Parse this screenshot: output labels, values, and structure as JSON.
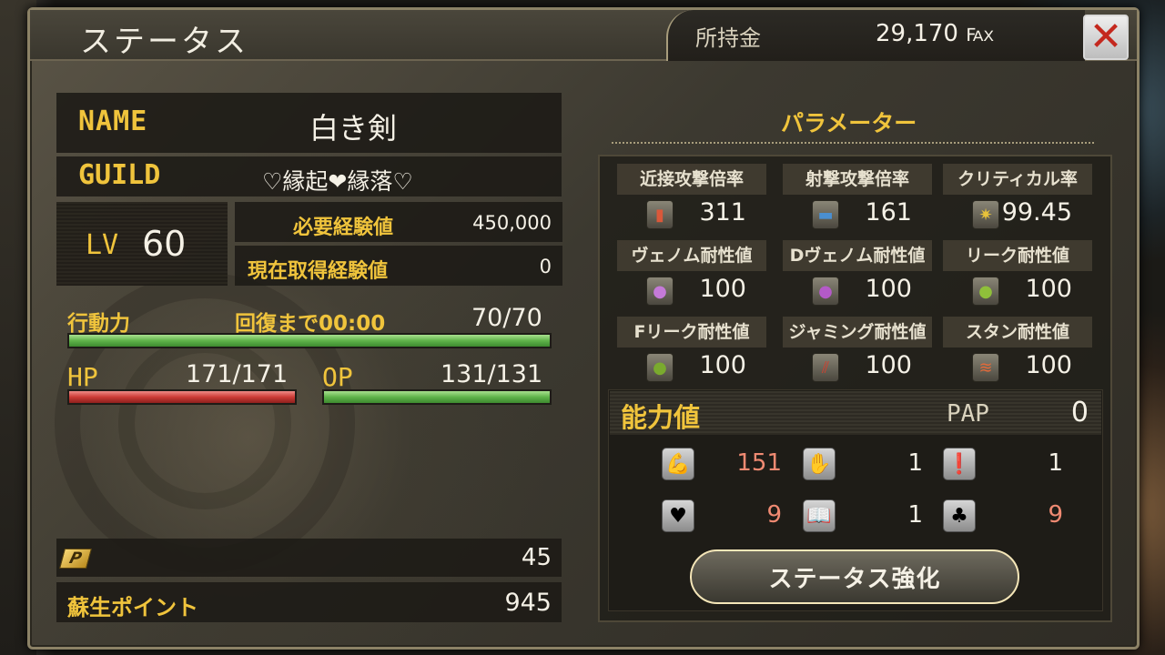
{
  "header": {
    "title": "ステータス",
    "money_label": "所持金",
    "money_value": "29,170 ℻"
  },
  "close_icon": "close-x-icon",
  "profile": {
    "name_label": "NAME",
    "name": "白き剣",
    "guild_label": "GUILD",
    "guild": "♡縁起❤縁落♡",
    "lv_label": "LV",
    "lv": "60",
    "exp_required_label": "必要経験値",
    "exp_required": "450,000",
    "exp_current_label": "現在取得経験値",
    "exp_current": "0"
  },
  "action": {
    "label": "行動力",
    "recover": "回復まで00:00",
    "value": "70/70",
    "fill": 1.0
  },
  "hp": {
    "label": "HP",
    "value": "171/171",
    "fill": 1.0
  },
  "op": {
    "label": "OP",
    "value": "131/131",
    "fill": 1.0
  },
  "points": {
    "p_icon": "p-points-icon",
    "p_value": "45",
    "revive_label": "蘇生ポイント",
    "revive_value": "945"
  },
  "parameters": {
    "title": "パラメーター",
    "items": [
      {
        "label": "近接攻撃倍率",
        "value": "311",
        "icon": "melee-weapon-icon",
        "color": "#d9583a"
      },
      {
        "label": "射撃攻撃倍率",
        "value": "161",
        "icon": "gun-icon",
        "color": "#4a8fd0"
      },
      {
        "label": "クリティカル率",
        "value": "99.45",
        "icon": "critical-burst-icon",
        "color": "#e8c23a"
      },
      {
        "label": "ヴェノム耐性値",
        "value": "100",
        "icon": "venom-shield-icon",
        "color": "#c57ad8"
      },
      {
        "label": "Dヴェノム耐性値",
        "value": "100",
        "icon": "d-venom-shield-icon",
        "color": "#b45ac8"
      },
      {
        "label": "リーク耐性値",
        "value": "100",
        "icon": "leak-shield-icon",
        "color": "#8fbf3a"
      },
      {
        "label": "Fリーク耐性値",
        "value": "100",
        "icon": "f-leak-shield-icon",
        "color": "#7aaa2e"
      },
      {
        "label": "ジャミング耐性値",
        "value": "100",
        "icon": "jamming-shield-icon",
        "color": "#d0402e"
      },
      {
        "label": "スタン耐性値",
        "value": "100",
        "icon": "stun-shield-icon",
        "color": "#e26a3a"
      }
    ]
  },
  "ability": {
    "title": "能力値",
    "pap_label": "PAP",
    "pap_value": "0",
    "items": [
      {
        "icon": "strength-arm-icon",
        "value": "151",
        "color": "#f08a72"
      },
      {
        "icon": "hand-icon",
        "value": "1",
        "color": "#f5f1e6"
      },
      {
        "icon": "mind-head-icon",
        "value": "1",
        "color": "#f5f1e6"
      },
      {
        "icon": "heart-icon",
        "value": "9",
        "color": "#f08a72"
      },
      {
        "icon": "book-icon",
        "value": "1",
        "color": "#f5f1e6"
      },
      {
        "icon": "clover-icon",
        "value": "9",
        "color": "#f08a72"
      }
    ],
    "button_label": "ステータス強化"
  }
}
